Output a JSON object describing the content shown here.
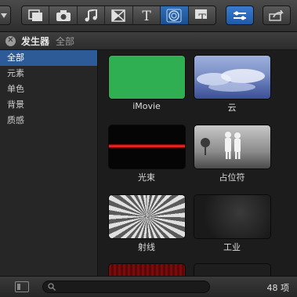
{
  "toolbar": {
    "buttons": [
      {
        "name": "clip-browser-icon"
      },
      {
        "name": "photo-browser-icon"
      },
      {
        "name": "music-browser-icon"
      },
      {
        "name": "transitions-browser-icon"
      },
      {
        "name": "titles-browser-icon"
      },
      {
        "name": "generators-browser-icon",
        "active": true
      },
      {
        "name": "themes-browser-icon"
      }
    ],
    "accent": "#2f6fb8"
  },
  "titlebar": {
    "title": "发生器",
    "crumb": "全部"
  },
  "sidebar": {
    "items": [
      {
        "label": "全部",
        "selected": true
      },
      {
        "label": "元素"
      },
      {
        "label": "单色"
      },
      {
        "label": "背景"
      },
      {
        "label": "质感"
      }
    ]
  },
  "grid": {
    "tiles": [
      {
        "label": "iMovie"
      },
      {
        "label": "云"
      },
      {
        "label": "光束"
      },
      {
        "label": "占位符"
      },
      {
        "label": "射线"
      },
      {
        "label": "工业"
      },
      {
        "label": ""
      },
      {
        "label": ""
      }
    ]
  },
  "bottombar": {
    "search_placeholder": "",
    "count": "48 项"
  }
}
